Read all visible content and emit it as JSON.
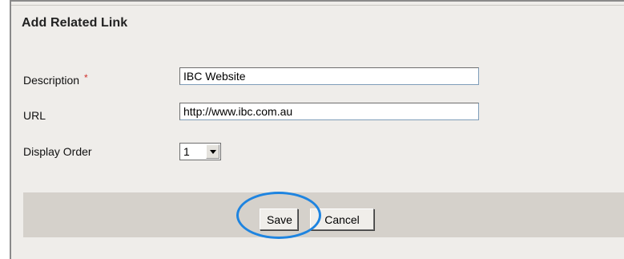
{
  "panel": {
    "title": "Add Related Link"
  },
  "form": {
    "description": {
      "label": "Description",
      "required_marker": "*",
      "value": "IBC Website"
    },
    "url": {
      "label": "URL",
      "value": "http://www.ibc.com.au"
    },
    "display_order": {
      "label": "Display Order",
      "selected": "1"
    }
  },
  "actions": {
    "save_label": "Save",
    "cancel_label": "Cancel"
  },
  "colors": {
    "panel_bg": "#efedea",
    "button_bar_bg": "#d5d1cb",
    "required_marker": "#d0312d",
    "highlight_ring": "#1e84e0"
  },
  "icons": {
    "select_arrow": "chevron-down-icon"
  }
}
